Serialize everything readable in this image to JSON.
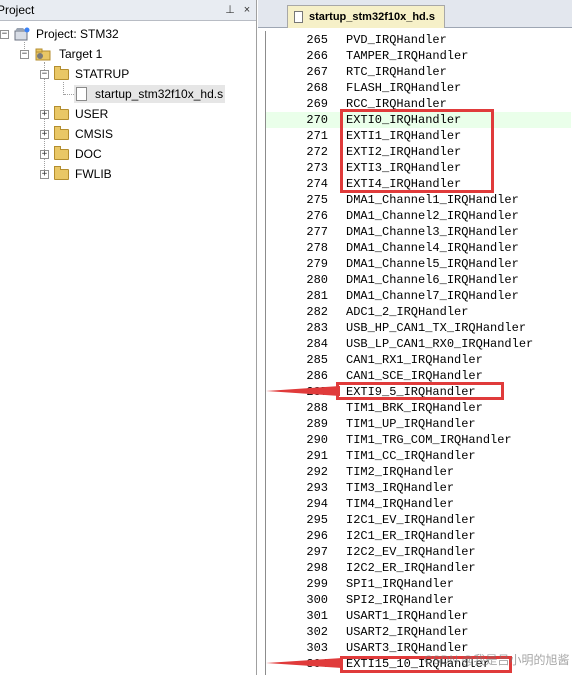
{
  "project_pane": {
    "title": "Project",
    "pin_label": "⊥",
    "close_label": "×",
    "tree": {
      "root": "Project: STM32",
      "target": "Target 1",
      "groups": [
        {
          "label": "STATRUP",
          "expanded": true,
          "files": [
            "startup_stm32f10x_hd.s"
          ]
        },
        {
          "label": "USER",
          "expanded": false
        },
        {
          "label": "CMSIS",
          "expanded": false
        },
        {
          "label": "DOC",
          "expanded": false
        },
        {
          "label": "FWLIB",
          "expanded": false
        }
      ]
    }
  },
  "editor": {
    "tab_label": "startup_stm32f10x_hd.s",
    "lines": [
      {
        "n": "265",
        "code": "PVD_IRQHandler"
      },
      {
        "n": "266",
        "code": "TAMPER_IRQHandler"
      },
      {
        "n": "267",
        "code": "RTC_IRQHandler"
      },
      {
        "n": "268",
        "code": "FLASH_IRQHandler"
      },
      {
        "n": "269",
        "code": "RCC_IRQHandler"
      },
      {
        "n": "270",
        "code": "EXTI0_IRQHandler"
      },
      {
        "n": "271",
        "code": "EXTI1_IRQHandler"
      },
      {
        "n": "272",
        "code": "EXTI2_IRQHandler"
      },
      {
        "n": "273",
        "code": "EXTI3_IRQHandler"
      },
      {
        "n": "274",
        "code": "EXTI4_IRQHandler"
      },
      {
        "n": "275",
        "code": "DMA1_Channel1_IRQHandler"
      },
      {
        "n": "276",
        "code": "DMA1_Channel2_IRQHandler"
      },
      {
        "n": "277",
        "code": "DMA1_Channel3_IRQHandler"
      },
      {
        "n": "278",
        "code": "DMA1_Channel4_IRQHandler"
      },
      {
        "n": "279",
        "code": "DMA1_Channel5_IRQHandler"
      },
      {
        "n": "280",
        "code": "DMA1_Channel6_IRQHandler"
      },
      {
        "n": "281",
        "code": "DMA1_Channel7_IRQHandler"
      },
      {
        "n": "282",
        "code": "ADC1_2_IRQHandler"
      },
      {
        "n": "283",
        "code": "USB_HP_CAN1_TX_IRQHandler"
      },
      {
        "n": "284",
        "code": "USB_LP_CAN1_RX0_IRQHandler"
      },
      {
        "n": "285",
        "code": "CAN1_RX1_IRQHandler"
      },
      {
        "n": "286",
        "code": "CAN1_SCE_IRQHandler"
      },
      {
        "n": "287",
        "code": "EXTI9_5_IRQHandler"
      },
      {
        "n": "288",
        "code": "TIM1_BRK_IRQHandler"
      },
      {
        "n": "289",
        "code": "TIM1_UP_IRQHandler"
      },
      {
        "n": "290",
        "code": "TIM1_TRG_COM_IRQHandler"
      },
      {
        "n": "291",
        "code": "TIM1_CC_IRQHandler"
      },
      {
        "n": "292",
        "code": "TIM2_IRQHandler"
      },
      {
        "n": "293",
        "code": "TIM3_IRQHandler"
      },
      {
        "n": "294",
        "code": "TIM4_IRQHandler"
      },
      {
        "n": "295",
        "code": "I2C1_EV_IRQHandler"
      },
      {
        "n": "296",
        "code": "I2C1_ER_IRQHandler"
      },
      {
        "n": "297",
        "code": "I2C2_EV_IRQHandler"
      },
      {
        "n": "298",
        "code": "I2C2_ER_IRQHandler"
      },
      {
        "n": "299",
        "code": "SPI1_IRQHandler"
      },
      {
        "n": "300",
        "code": "SPI2_IRQHandler"
      },
      {
        "n": "301",
        "code": "USART1_IRQHandler"
      },
      {
        "n": "302",
        "code": "USART2_IRQHandler"
      },
      {
        "n": "303",
        "code": "USART3_IRQHandler"
      },
      {
        "n": "304",
        "code": "EXTI15_10_IRQHandler"
      }
    ],
    "current_line": "270"
  },
  "watermark": "CSDN @我是吕小明的旭酱",
  "colors": {
    "highlight_box": "#e03b3b",
    "current_line_bg": "#eaffea",
    "tab_bg": "#f6f0c8"
  }
}
